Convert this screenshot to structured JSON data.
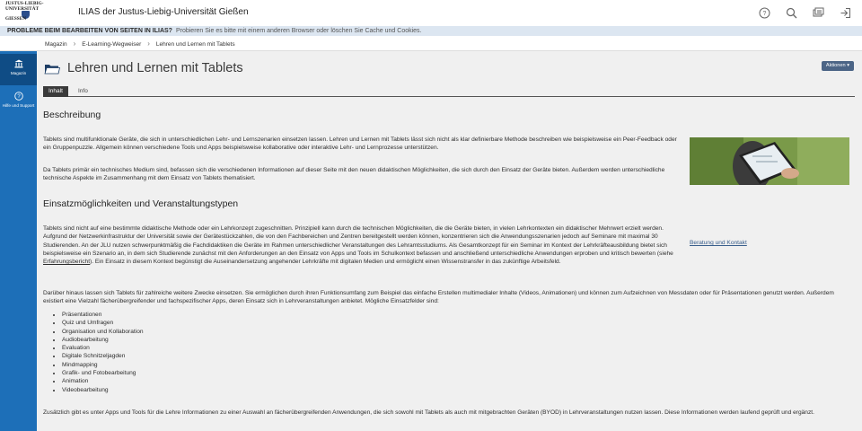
{
  "header": {
    "logo_lines": [
      "JUSTUS-LIEBIG-",
      "UNIVERSITÄT",
      "GIESSEN"
    ],
    "title": "ILIAS der Justus-Liebig-Universität Gießen",
    "icons": [
      "help-icon",
      "search-icon",
      "notifications-icon",
      "logout-icon"
    ]
  },
  "notice": {
    "bold": "PROBLEME BEIM BEARBEITEN VON SEITEN IN ILIAS?",
    "text": "Probieren Sie es bitte mit einem anderen Browser oder löschen Sie Cache und Cookies."
  },
  "breadcrumb": [
    "Magazin",
    "E-Learning-Wegweiser",
    "Lehren und Lernen mit Tablets"
  ],
  "rail": [
    {
      "label": "Magazin",
      "icon": "library-icon"
    },
    {
      "label": "Hilfe und Support",
      "icon": "help-circle-icon"
    }
  ],
  "page": {
    "title": "Lehren und Lernen mit Tablets",
    "actions_label": "Aktionen",
    "tabs": [
      "Inhalt",
      "Info"
    ]
  },
  "section1": {
    "heading": "Beschreibung",
    "p1": "Tablets sind multifunktionale Geräte, die sich in unterschiedlichen Lehr- und Lernszenarien einsetzen lassen. Lehren und Lernen mit Tablets lässt sich nicht als klar definierbare Methode beschreiben wie beispielsweise ein Peer-Feedback oder ein Gruppenpuzzle. Allgemein können verschiedene Tools und Apps beispielsweise kollaborative oder interaktive Lehr- und Lernprozesse unterstützen.",
    "p2": "Da Tablets primär ein technisches Medium sind, befassen sich die verschiedenen Informationen auf dieser Seite mit den neuen didaktischen Möglichkeiten, die sich durch den Einsatz der Geräte bieten. Außerdem werden unterschiedliche technische Aspekte im Zusammenhang mit dem Einsatz von Tablets thematisiert."
  },
  "section2": {
    "heading": "Einsatzmöglichkeiten und Veranstaltungstypen",
    "p1_before": "Tablets sind nicht auf eine bestimmte didaktische Methode oder ein Lehrkonzept zugeschnitten. Prinzipiell kann durch die technischen Möglichkeiten, die die Geräte bieten, in vielen Lehrkontexten ein didaktischer Mehrwert erzielt werden. Aufgrund der Netzwerkinfrastruktur der Universität sowie der Gerätestückzahlen, die von den Fachbereichen und Zentren bereitgestellt werden können, konzentrieren sich die Anwendungsszenarien jedoch auf Seminare mit maximal 30 Studierenden. An der JLU nutzen schwerpunktmäßig die Fachdidaktiken die Geräte im Rahmen unterschiedlicher Veranstaltungen des Lehramtsstudiums. Als Gesamtkonzept für ein Seminar im Kontext der Lehrkräfteausbildung bietet sich beispielsweise ein Szenario an, in dem sich Studierende zunächst mit den Anforderungen an den Einsatz von Apps und Tools im Schulkontext befassen und anschließend unterschiedliche Anwendungen erproben und kritisch bewerten (siehe ",
    "p1_link": "Erfahrungsbericht",
    "p1_after": "). Ein Einsatz in diesem Kontext begünstigt die Auseinandersetzung angehender Lehrkräfte mit digitalen Medien und ermöglicht einen Wissenstransfer in das zukünftige Arbeitsfeld.",
    "side_link": "Beratung und Kontakt",
    "p2": "Darüber hinaus lassen sich Tablets für zahlreiche weitere Zwecke einsetzen. Sie ermöglichen durch ihren Funktionsumfang zum Beispiel das einfache Erstellen multimedialer Inhalte (Videos, Animationen) und können zum Aufzeichnen von Messdaten oder für Präsentationen genutzt werden. Außerdem existiert eine Vielzahl fächerübergreifender und fachspezifischer Apps, deren Einsatz sich in Lehrveranstaltungen anbietet. Mögliche Einsatzfelder sind:",
    "list": [
      "Präsentationen",
      "Quiz und Umfragen",
      "Organisation und Kollaboration",
      "Audiobearbeitung",
      "Evaluation",
      "Digitale Schnitzeljagden",
      "Mindmapping",
      "Grafik- und Fotobearbeitung",
      "Animation",
      "Videobearbeitung"
    ],
    "p3": "Zusätzlich gibt es unter Apps und Tools für die Lehre Informationen zu einer Auswahl an fächerübergreifenden Anwendungen, die sich sowohl mit Tablets als auch mit mitgebrachten Geräten (BYOD) in Lehrveranstaltungen nutzen lassen. Diese Informationen werden laufend geprüft und ergänzt."
  },
  "colors": {
    "rail": "#1d6fb8",
    "rail_active": "#0f4c85",
    "notice": "#dce6f1",
    "actions": "#4c6586"
  }
}
